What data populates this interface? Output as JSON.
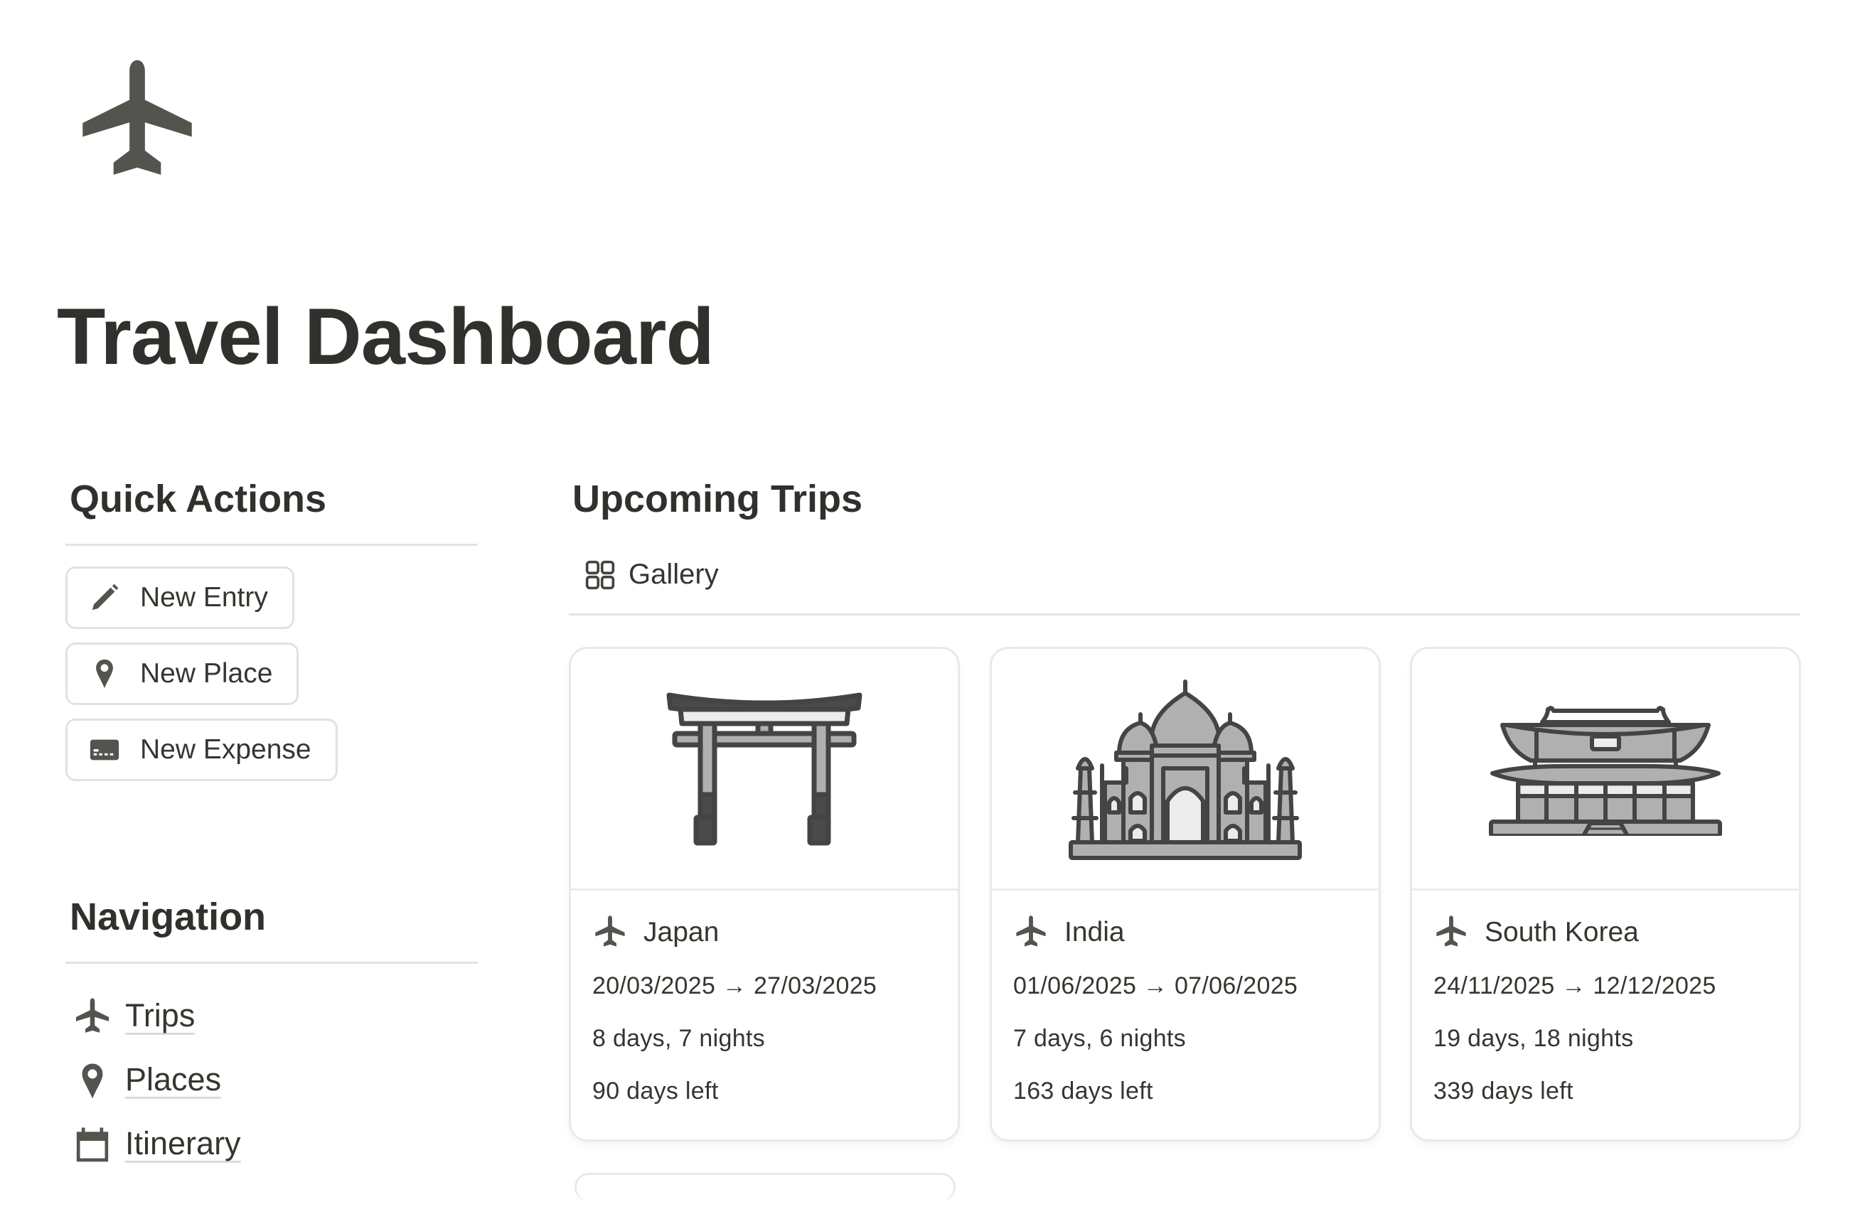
{
  "page": {
    "icon": "airplane-icon",
    "title": "Travel Dashboard"
  },
  "quick_actions": {
    "heading": "Quick Actions",
    "buttons": [
      {
        "label": "New Entry",
        "icon": "pencil-icon"
      },
      {
        "label": "New Place",
        "icon": "map-pin-icon"
      },
      {
        "label": "New Expense",
        "icon": "credit-card-icon"
      }
    ]
  },
  "navigation": {
    "heading": "Navigation",
    "items": [
      {
        "label": "Trips",
        "icon": "airplane-icon"
      },
      {
        "label": "Places",
        "icon": "map-pin-icon"
      },
      {
        "label": "Itinerary",
        "icon": "calendar-icon"
      }
    ]
  },
  "upcoming_trips": {
    "heading": "Upcoming Trips",
    "view_tab": {
      "label": "Gallery",
      "icon": "gallery-grid-icon"
    },
    "cards": [
      {
        "title": "Japan",
        "cover": "torii-gate-illustration",
        "dates": "20/03/2025 → 27/03/2025",
        "duration": "8 days, 7 nights",
        "countdown": "90 days left"
      },
      {
        "title": "India",
        "cover": "taj-mahal-illustration",
        "dates": "01/06/2025 → 07/06/2025",
        "duration": "7 days, 6 nights",
        "countdown": "163 days left"
      },
      {
        "title": "South Korea",
        "cover": "korean-palace-illustration",
        "dates": "24/11/2025 → 12/12/2025",
        "duration": "19 days, 18 nights",
        "countdown": "339 days left"
      }
    ]
  },
  "colors": {
    "text": "#37352f",
    "icon": "#55534e",
    "border": "#e3e2e0",
    "illustration_dark": "#444444",
    "illustration_mid": "#b0b0b0",
    "illustration_light": "#ececec"
  }
}
